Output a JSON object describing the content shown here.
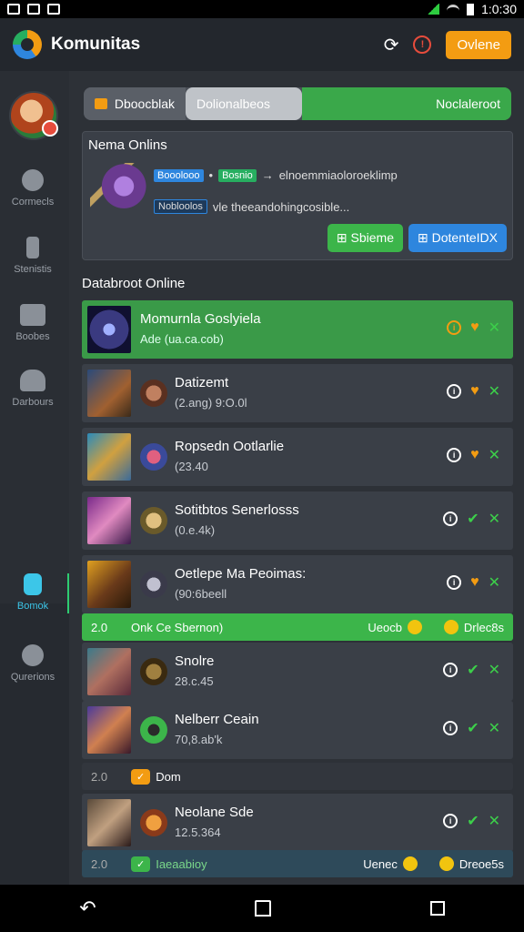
{
  "status": {
    "time": "1:0:30"
  },
  "appbar": {
    "title": "Komunitas",
    "button_label": "Ovlene",
    "alert_icon": "!"
  },
  "sidebar": {
    "items": [
      {
        "label": "Cormecls",
        "icon": "pie-chart-icon"
      },
      {
        "label": "Stenistis",
        "icon": "music-note-icon"
      },
      {
        "label": "Boobes",
        "icon": "card-icon"
      },
      {
        "label": "Darbours",
        "icon": "people-icon"
      },
      {
        "label": "Bomok",
        "icon": "device-icon",
        "active": true
      },
      {
        "label": "Qurerions",
        "icon": "gear-icon"
      }
    ]
  },
  "tabs": {
    "tab1": "Dboocblak",
    "tab2": "Dolionalbeos",
    "tab3": "Noclaleroot"
  },
  "news": {
    "title": "Nema Onlins",
    "chip1": "Booolooo",
    "chip2": "Bosnio",
    "line1": "elnoemmiaoloroeklimp",
    "chip3": "Nobloolos",
    "line2": "vle theeandohingcosible...",
    "btn_share": "Sbieme",
    "btn_dl": "DotenteIDX"
  },
  "section_title": "Databroot Online",
  "rows": [
    {
      "name": "Momurnla Goslyiela",
      "sub": "Ade (ua.ca.cob)"
    },
    {
      "name": "Datizemt",
      "sub": "(2.ang) 9:O.0l"
    },
    {
      "name": "Ropsedn Ootlarlie",
      "sub": "(23.40"
    },
    {
      "name": "Sotitbtos Senerlosss",
      "sub": "(0.e.4k)"
    },
    {
      "name": "Oetlepe Ma Peoimas:",
      "sub": "(90:6beell"
    },
    {
      "name": "Snolre",
      "sub": "28.c.45"
    },
    {
      "name": "Nelberr Ceain",
      "sub": "70,8.ab'k"
    },
    {
      "name": "Neolane Sde",
      "sub": "12.5.364"
    }
  ],
  "bands": {
    "green": {
      "num": "2.0",
      "label": "Onk Ce Sbernon)",
      "right1": "Ueocb",
      "right2": "Drlec8s"
    },
    "dark": {
      "num": "2.0",
      "label": "Dom"
    },
    "teal": {
      "num": "2.0",
      "label": "Iaeaabioy",
      "right1": "Uenec",
      "right2": "Dreoe5s"
    }
  },
  "colors": {
    "accent_green": "#3cb54a",
    "accent_orange": "#f39c12",
    "accent_blue": "#2e86de"
  }
}
